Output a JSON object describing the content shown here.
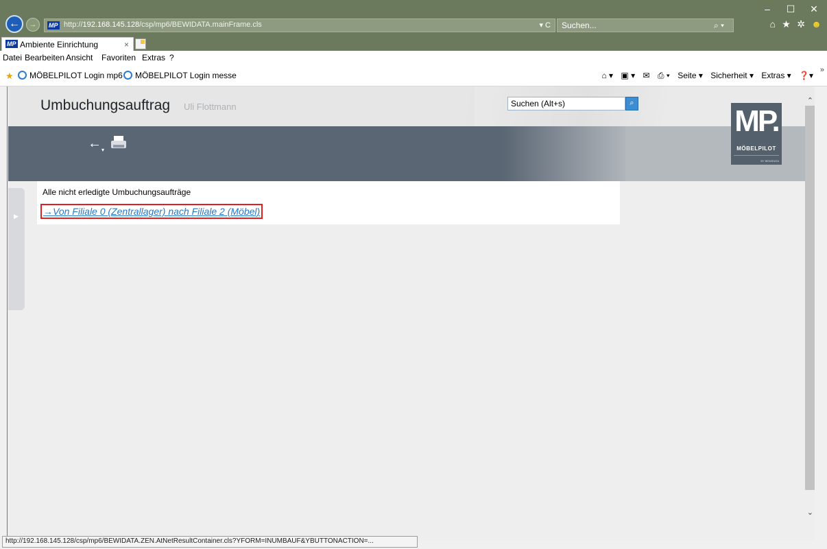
{
  "browser": {
    "url_prefix": "http://",
    "url_host": "192.168.145.128",
    "url_path": "/csp/mp6/BEWIDATA.mainFrame.cls",
    "address_tools": "▾ C",
    "search_placeholder": "Suchen...",
    "search_icon": "⌕ ▾",
    "tab_title": "Ambiente Einrichtung",
    "tab_close": "×",
    "menu": [
      "Datei",
      "Bearbeiten",
      "Ansicht",
      "Favoriten",
      "Extras",
      "?"
    ],
    "favorites": [
      "MÖBELPILOT Login mp6",
      "MÖBELPILOT Login messe"
    ],
    "command_bar": {
      "seite": "Seite ▾",
      "sicherheit": "Sicherheit ▾",
      "extras": "Extras ▾"
    },
    "window_controls": {
      "minimize": "–",
      "maximize": "☐",
      "close": "✕"
    },
    "status_text": "http://192.168.145.128/csp/mp6/BEWIDATA.ZEN.AtNetResultContainer.cls?YFORM=INUMBAUF&YBUTTONACTION=..."
  },
  "app": {
    "logo_mini": "MP",
    "title": "Umbuchungsauftrag",
    "user": "Uli Flottmann",
    "search_placeholder": "Suchen (Alt+s)",
    "logo": {
      "mark": "MP.",
      "brand": "MÖBELPILOT",
      "by": "BY BEWIDATA"
    }
  },
  "content": {
    "caption": "Alle nicht erledigte Umbuchungsaufträge",
    "links": [
      {
        "label": "→Von Filiale 0 (Zentrallager) nach Filiale 2 (Möbel)"
      }
    ]
  },
  "icons": [
    "back-icon",
    "forward-icon",
    "refresh-icon",
    "search-icon",
    "home-icon",
    "favorites-star-icon",
    "settings-gear-icon",
    "smiley-icon",
    "new-tab-icon",
    "print-icon",
    "toolbar-back-icon",
    "app-search-icon",
    "scroll-up-icon",
    "scroll-down-icon",
    "side-panel-arrow-icon"
  ],
  "colors": {
    "chrome": "#6b7a5c",
    "toolbar": "#5a6673",
    "link": "#2877c4",
    "highlight": "#e02020"
  }
}
